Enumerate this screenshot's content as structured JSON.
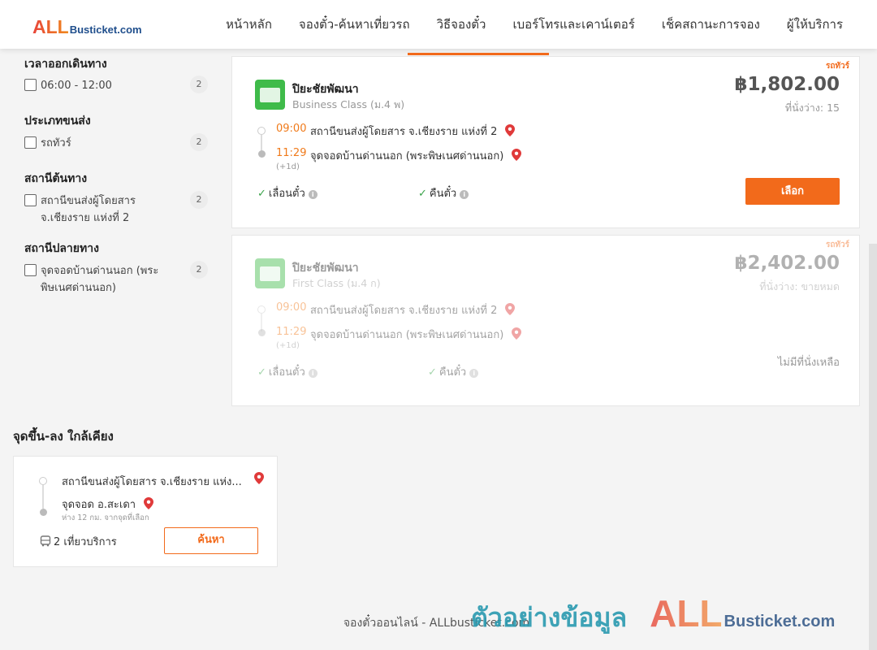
{
  "logo": {
    "brand_all": "ALL",
    "brand_rest": "Busticket.com"
  },
  "nav": [
    "หน้าหลัก",
    "จองตั๋ว-ค้นหาเที่ยวรถ",
    "วิธีจองตั๋ว",
    "เบอร์โทรและเคาน์เตอร์",
    "เช็คสถานะการจอง",
    "ผู้ให้บริการ"
  ],
  "filters": {
    "departure_time": {
      "title": "เวลาออกเดินทาง",
      "options": [
        {
          "label": "06:00 - 12:00",
          "count": "2"
        }
      ]
    },
    "transport_type": {
      "title": "ประเภทขนส่ง",
      "options": [
        {
          "label": "รถทัวร์",
          "count": "2"
        }
      ]
    },
    "origin": {
      "title": "สถานีต้นทาง",
      "options": [
        {
          "label": "สถานีขนส่งผู้โดยสาร จ.เชียงราย แห่งที่ 2",
          "count": "2"
        }
      ]
    },
    "destination": {
      "title": "สถานีปลายทาง",
      "options": [
        {
          "label": "จุดจอดบ้านด่านนอก (พระพิษเนศด่านนอก)",
          "count": "2"
        }
      ]
    }
  },
  "results": [
    {
      "badge": "รถทัวร์",
      "operator": "ปิยะชัยพัฒนา",
      "class": "Business Class (ม.4 พ)",
      "price": "฿1,802.00",
      "seats": "ที่นั่งว่าง: 15",
      "depart_time": "09:00",
      "depart_place": "สถานีขนส่งผู้โดยสาร จ.เชียงราย แห่งที่ 2",
      "arrive_time": "11:29",
      "arrive_place": "จุดจอดบ้านด่านนอก (พระพิษเนศด่านนอก)",
      "day_offset": "(+1d)",
      "feature_1": "เลื่อนตั๋ว",
      "feature_2": "คืนตั๋ว",
      "action": "เลือก"
    },
    {
      "badge": "รถทัวร์",
      "operator": "ปิยะชัยพัฒนา",
      "class": "First Class (ม.4 ก)",
      "price": "฿2,402.00",
      "seats": "ที่นั่งว่าง: ขายหมด",
      "depart_time": "09:00",
      "depart_place": "สถานีขนส่งผู้โดยสาร จ.เชียงราย แห่งที่ 2",
      "arrive_time": "11:29",
      "arrive_place": "จุดจอดบ้านด่านนอก (พระพิษเนศด่านนอก)",
      "day_offset": "(+1d)",
      "feature_1": "เลื่อนตั๋ว",
      "feature_2": "คืนตั๋ว",
      "status": "ไม่มีที่นั่งเหลือ"
    }
  ],
  "nearby": {
    "title": "จุดขึ้น-ลง ใกล้เคียง",
    "from": "สถานีขนส่งผู้โดยสาร จ.เชียงราย แห่ง...",
    "to": "จุดจอด อ.สะเดา",
    "distance": "ห่าง 12 กม. จากจุดที่เลือก",
    "trips": "2 เที่ยวบริการ",
    "search_button": "ค้นหา"
  },
  "footer": "จองตั๋วออนไลน์ - ALLbusticket.com",
  "watermark": {
    "text": "ตัวอย่างข้อมูล",
    "brand_all": "ALL",
    "brand_rest": "Busticket.com"
  },
  "colors": {
    "accent": "#f26a1b",
    "time": "#f07a1a",
    "check": "#3aa34a",
    "pin": "#e03a3a",
    "operator_logo": "#3fbb4a"
  },
  "icons": [
    "checkbox",
    "location-pin-icon",
    "check-icon",
    "info-icon",
    "bus-icon"
  ]
}
